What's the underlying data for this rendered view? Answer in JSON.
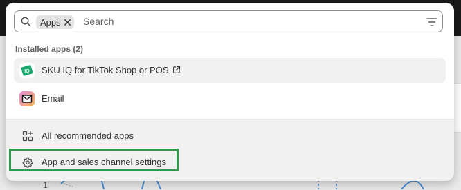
{
  "search": {
    "tag_label": "Apps",
    "placeholder": "Search"
  },
  "installed_apps": {
    "heading": "Installed apps (2)",
    "items": [
      {
        "label": "SKU IQ for TikTok Shop or POS",
        "icon": "sku-iq-app-icon",
        "external": true
      },
      {
        "label": "Email",
        "icon": "email-app-icon",
        "external": false
      }
    ]
  },
  "nav": {
    "items": [
      {
        "label": "All recommended apps",
        "icon": "apps-grid-icon"
      },
      {
        "label": "App and sales channel settings",
        "icon": "gear-icon",
        "highlighted": true
      }
    ]
  },
  "background": {
    "axis_label": "1"
  },
  "colors": {
    "highlight_border": "#2e9a4a",
    "sku_iq_brand": "#16a56b",
    "email_gradient_start": "#e58bd6",
    "email_gradient_end": "#f2b457"
  }
}
